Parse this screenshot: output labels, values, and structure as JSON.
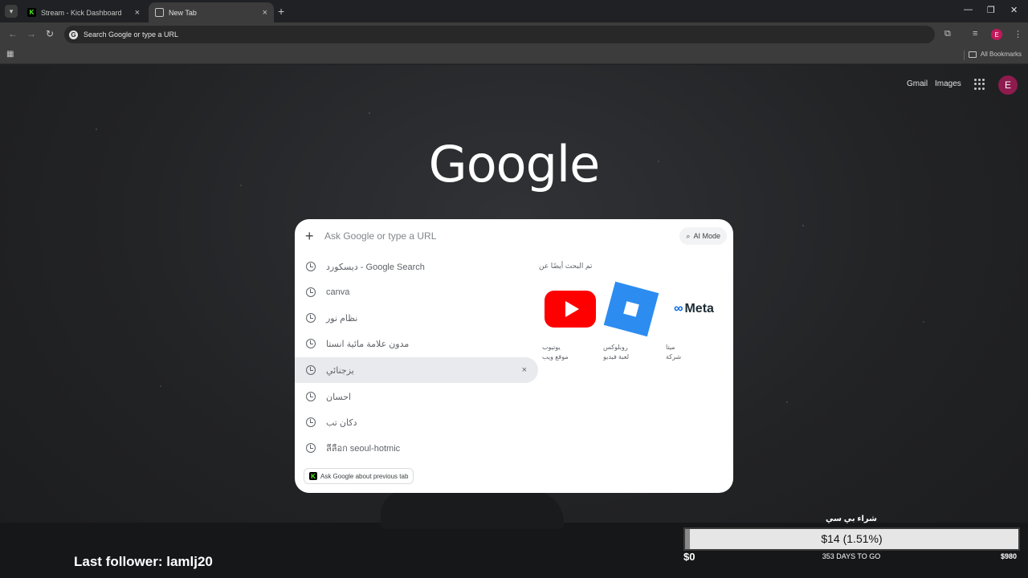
{
  "browser": {
    "tabs": [
      {
        "title": "Stream - Kick Dashboard",
        "favicon": "kick-icon",
        "active": false
      },
      {
        "title": "New Tab",
        "favicon": "globe-icon",
        "active": true
      }
    ],
    "new_tab_symbol": "+",
    "close_symbol": "×",
    "omnibox_text": "Search Google or type a URL",
    "profile_initial": "E",
    "bookmarks_label": "All Bookmarks"
  },
  "page": {
    "top_links": [
      "Gmail",
      "Images"
    ],
    "logo_text": "Google",
    "profile_initial": "E"
  },
  "dropdown": {
    "placeholder": "Ask Google or type a URL",
    "ai_mode_label": "AI Mode",
    "suggestions": [
      "ديسكورد - Google Search",
      "canva",
      "نظام نور",
      "مدون علامة مائية انستا",
      "يزجنائي",
      "احسان",
      "دكان تب",
      "ลีลือก seoul-hotmic"
    ],
    "selected_index": 4,
    "people_also_search": "تم البحث أيضًا عن",
    "related": [
      {
        "name": "يوتيوب",
        "sub": "موقع ويب",
        "logo": "youtube-logo"
      },
      {
        "name": "روبلوكس",
        "sub": "لعبة فيديو",
        "logo": "roblox-logo"
      },
      {
        "name": "ميتا",
        "sub": "شركة",
        "logo": "meta-logo",
        "text": "Meta"
      }
    ],
    "ask_chip_label": "Ask Google about previous tab"
  },
  "overlay": {
    "last_follower": "Last follower: lamlj20",
    "goal_title": "شراء بي سي",
    "goal_text": "$14 (1.51%)",
    "goal_progress": 0.0151,
    "goal_min": "$0",
    "goal_max": "$980",
    "goal_days": "353 DAYS TO GO"
  },
  "colors": {
    "accent_kick": "#53fc18",
    "profile": "#c2185b",
    "youtube": "#ff0000",
    "roblox": "#2d8cf0",
    "meta": "#0668e1"
  }
}
